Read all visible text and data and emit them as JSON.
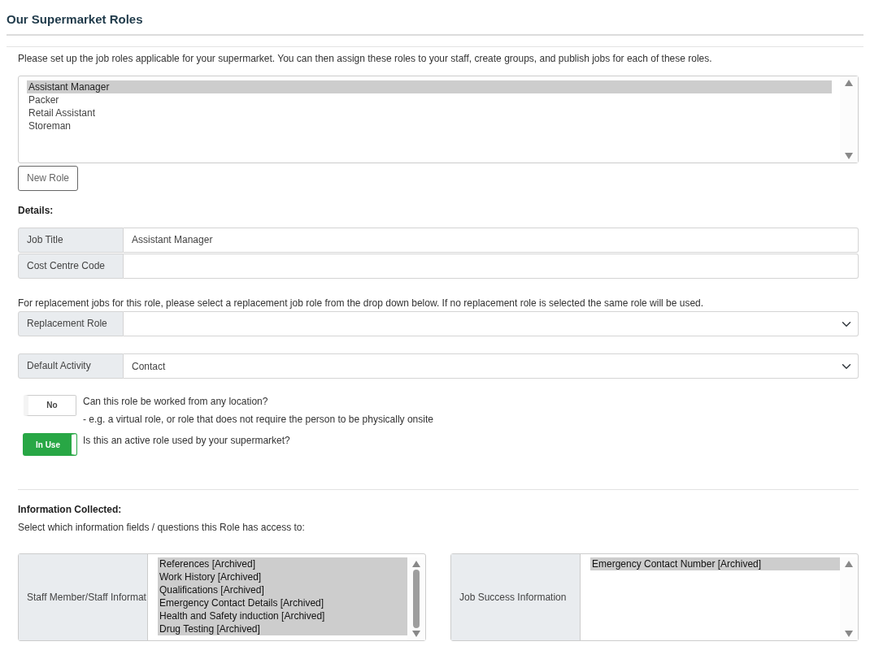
{
  "page_title": "Our Supermarket Roles",
  "intro": "Please set up the job roles applicable for your supermarket. You can then assign these roles to your staff, create groups, and publish jobs for each of these roles.",
  "roles": [
    {
      "label": "Assistant Manager",
      "selected": true
    },
    {
      "label": "Packer",
      "selected": false
    },
    {
      "label": "Retail Assistant",
      "selected": false
    },
    {
      "label": "Storeman",
      "selected": false
    }
  ],
  "new_role_button": "New Role",
  "details_heading": "Details:",
  "detail_fields": [
    {
      "label": "Job Title",
      "value": "Assistant Manager"
    },
    {
      "label": "Cost Centre Code"
    }
  ],
  "replacement_note": "For replacement jobs for this role, please select a replacement job role from the drop down below. If no replacement role is selected the same role will be used.",
  "replacement_role": {
    "label": "Replacement Role"
  },
  "default_activity": {
    "label": "Default Activity",
    "value": "Contact"
  },
  "toggles": [
    {
      "label": "No",
      "on": false,
      "question": "Can this role be worked from any location?",
      "hint": "- e.g. a virtual role, or role that does not require the person to be physically onsite"
    },
    {
      "label": "In Use",
      "on": true,
      "question": "Is this an active role used by your supermarket?"
    }
  ],
  "info_heading": "Information Collected:",
  "info_note": "Select which information fields / questions this Role has access to:",
  "info_lists": [
    {
      "label": "Staff Member/Staff Informat",
      "items": [
        {
          "label": "References [Archived]",
          "selected": true
        },
        {
          "label": "Work History [Archived]",
          "selected": true
        },
        {
          "label": "Qualifications [Archived]",
          "selected": true
        },
        {
          "label": "Emergency Contact Details [Archived]",
          "selected": true
        },
        {
          "label": "Health and Safety induction [Archived]",
          "selected": true
        },
        {
          "label": "Drug Testing [Archived]",
          "selected": true
        }
      ]
    },
    {
      "label": "Job Success Information",
      "items": [
        {
          "label": "Emergency Contact Number [Archived]",
          "selected": true
        }
      ]
    }
  ]
}
